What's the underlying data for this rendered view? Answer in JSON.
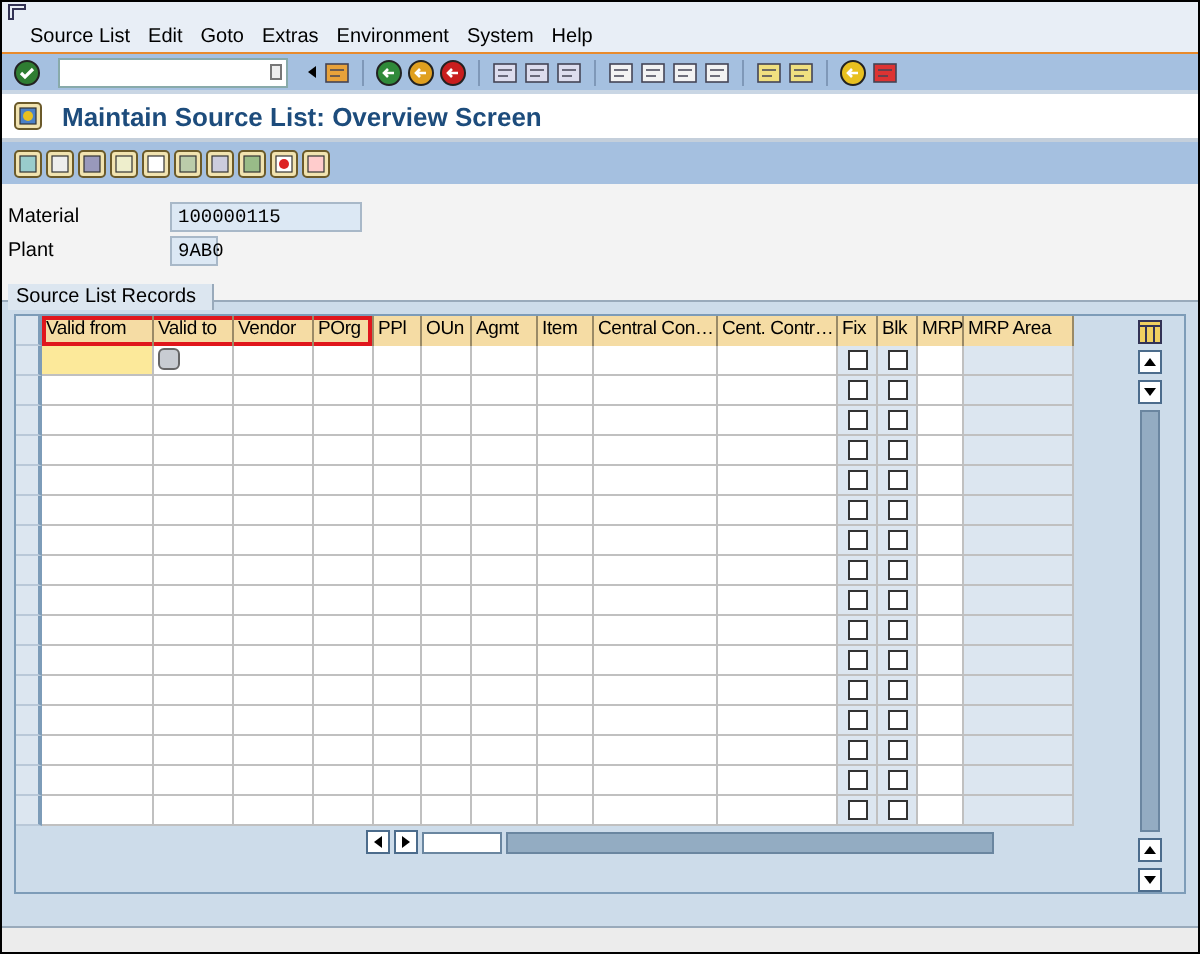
{
  "menu": [
    "Source List",
    "Edit",
    "Goto",
    "Extras",
    "Environment",
    "System",
    "Help"
  ],
  "title": "Maintain Source List: Overview Screen",
  "fields": [
    {
      "label": "Material",
      "value": "100000115"
    },
    {
      "label": "Plant",
      "value": "9AB0"
    }
  ],
  "table": {
    "tab": "Source List Records",
    "columns": [
      {
        "label": "Valid from",
        "kind": "text",
        "highlighted": true
      },
      {
        "label": "Valid to",
        "kind": "text",
        "highlighted": true
      },
      {
        "label": "Vendor",
        "kind": "text",
        "highlighted": true
      },
      {
        "label": "POrg",
        "kind": "text",
        "highlighted": true
      },
      {
        "label": "PPl",
        "kind": "text",
        "highlighted": false
      },
      {
        "label": "OUn",
        "kind": "text",
        "highlighted": false
      },
      {
        "label": "Agmt",
        "kind": "text",
        "highlighted": false
      },
      {
        "label": "Item",
        "kind": "text",
        "highlighted": false
      },
      {
        "label": "Central Con…",
        "kind": "text",
        "highlighted": false
      },
      {
        "label": "Cent. Contr…",
        "kind": "text",
        "highlighted": false
      },
      {
        "label": "Fix",
        "kind": "check",
        "highlighted": false
      },
      {
        "label": "Blk",
        "kind": "check",
        "highlighted": false
      },
      {
        "label": "MRP",
        "kind": "text",
        "highlighted": false
      },
      {
        "label": "MRP Area",
        "kind": "shaded",
        "highlighted": false
      }
    ],
    "rows": [
      {
        "focused": true,
        "checks": [
          false,
          false
        ]
      },
      {
        "focused": false,
        "checks": [
          false,
          false
        ]
      },
      {
        "focused": false,
        "checks": [
          false,
          false
        ]
      },
      {
        "focused": false,
        "checks": [
          false,
          false
        ]
      },
      {
        "focused": false,
        "checks": [
          false,
          false
        ]
      },
      {
        "focused": false,
        "checks": [
          false,
          false
        ]
      },
      {
        "focused": false,
        "checks": [
          false,
          false
        ]
      },
      {
        "focused": false,
        "checks": [
          false,
          false
        ]
      },
      {
        "focused": false,
        "checks": [
          false,
          false
        ]
      },
      {
        "focused": false,
        "checks": [
          false,
          false
        ]
      },
      {
        "focused": false,
        "checks": [
          false,
          false
        ]
      },
      {
        "focused": false,
        "checks": [
          false,
          false
        ]
      },
      {
        "focused": false,
        "checks": [
          false,
          false
        ]
      },
      {
        "focused": false,
        "checks": [
          false,
          false
        ]
      },
      {
        "focused": false,
        "checks": [
          false,
          false
        ]
      },
      {
        "focused": false,
        "checks": [
          false,
          false
        ]
      }
    ]
  }
}
